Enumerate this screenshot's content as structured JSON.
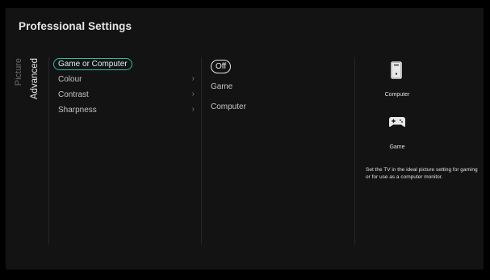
{
  "page": {
    "title": "Professional Settings"
  },
  "tabs": [
    {
      "label": "Picture",
      "active": false
    },
    {
      "label": "Advanced",
      "active": true
    }
  ],
  "menu": {
    "items": [
      {
        "label": "Game or Computer",
        "selected": true,
        "has_submenu": false
      },
      {
        "label": "Colour",
        "selected": false,
        "has_submenu": true
      },
      {
        "label": "Contrast",
        "selected": false,
        "has_submenu": true
      },
      {
        "label": "Sharpness",
        "selected": false,
        "has_submenu": true
      }
    ],
    "chevron_icon": "chevron-right-icon"
  },
  "options": {
    "items": [
      {
        "label": "Off",
        "selected": true
      },
      {
        "label": "Game",
        "selected": false
      },
      {
        "label": "Computer",
        "selected": false
      }
    ]
  },
  "info": {
    "computer": {
      "label": "Computer",
      "icon": "computer-tower-icon"
    },
    "game": {
      "label": "Game",
      "icon": "gamepad-icon"
    },
    "description": "Set the TV in the ideal picture setting for gaming or for use as a computer monitor."
  },
  "colors": {
    "background": "#131313",
    "accent": "#2fb8ad",
    "text": "#c4c4c4",
    "text_bright": "#e6e6e6",
    "text_dim": "#6c6c6c"
  }
}
